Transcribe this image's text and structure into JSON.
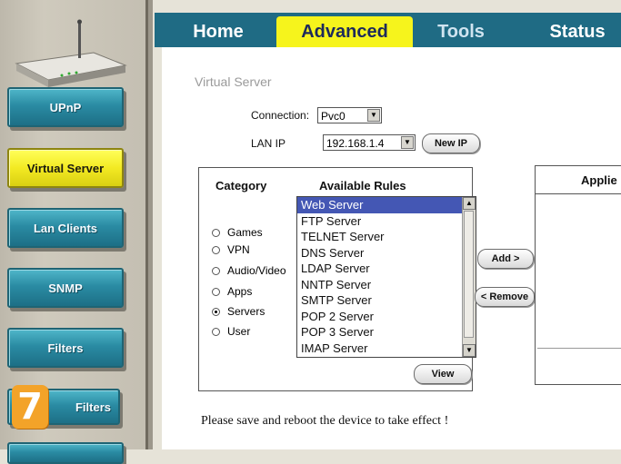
{
  "sidebar": {
    "items": [
      {
        "label": "UPnP"
      },
      {
        "label": "Virtual Server"
      },
      {
        "label": "Lan Clients"
      },
      {
        "label": "SNMP"
      },
      {
        "label": "Filters"
      },
      {
        "label": "Filters"
      }
    ],
    "badge": "7"
  },
  "tabs": [
    {
      "label": "Home"
    },
    {
      "label": "Advanced"
    },
    {
      "label": "Tools"
    },
    {
      "label": "Status"
    }
  ],
  "page": {
    "section_title": "Virtual Server",
    "connection_label": "Connection:",
    "connection_value": "Pvc0",
    "lan_ip_label": "LAN IP",
    "lan_ip_value": "192.168.1.4",
    "new_ip_button": "New IP",
    "category_header": "Category",
    "available_rules_header": "Available Rules",
    "categories": [
      {
        "label": "Games",
        "selected": false
      },
      {
        "label": "VPN",
        "selected": false
      },
      {
        "label": "Audio/Video",
        "selected": false
      },
      {
        "label": "Apps",
        "selected": false
      },
      {
        "label": "Servers",
        "selected": true
      },
      {
        "label": "User",
        "selected": false
      }
    ],
    "rules": [
      "Web Server",
      "FTP Server",
      "TELNET Server",
      "DNS Server",
      "LDAP Server",
      "NNTP Server",
      "SMTP Server",
      "POP 2 Server",
      "POP 3 Server",
      "IMAP Server"
    ],
    "selected_rule": "Web Server",
    "view_button": "View",
    "add_button": "Add >",
    "remove_button": "< Remove",
    "applied_header": "Applie",
    "footer_message": "Please save and reboot the device to take effect !"
  },
  "colors": {
    "accent_teal": "#2a8ba3",
    "active_yellow": "#f3ea23",
    "tab_bar": "#1f6b84",
    "selection": "#4457b4",
    "badge": "#f3a329"
  }
}
